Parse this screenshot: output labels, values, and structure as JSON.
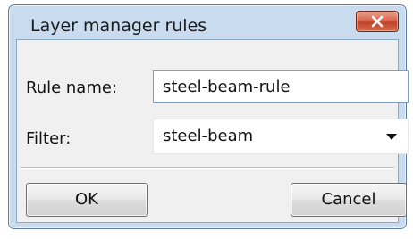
{
  "dialog": {
    "title": "Layer manager rules",
    "close_icon": "close-x-icon"
  },
  "form": {
    "rule_name_label": "Rule name:",
    "rule_name_value": "steel-beam-rule",
    "filter_label": "Filter:",
    "filter_selected": "steel-beam",
    "filter_dropdown_icon": "chevron-down-icon"
  },
  "buttons": {
    "ok_label": "OK",
    "cancel_label": "Cancel"
  },
  "colors": {
    "frame": "#c9dcef",
    "close_button": "#c2412b",
    "client_bg": "#f0f0f0"
  }
}
